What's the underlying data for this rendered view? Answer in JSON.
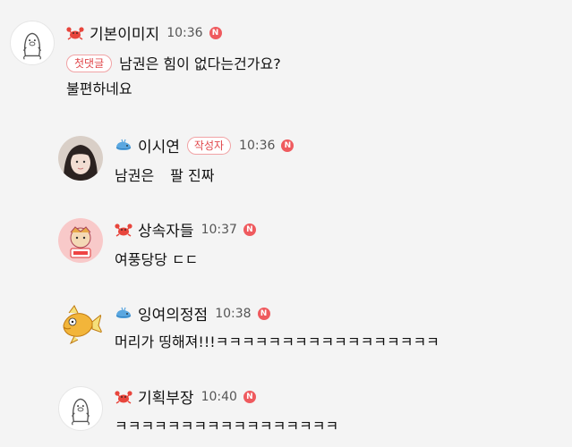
{
  "comments": [
    {
      "nickname": "기본이미지",
      "time": "10:36",
      "new_badge": "N",
      "first_comment_badge": "첫댓글",
      "line1": "남권은 힘이 없다는건가요?",
      "line2": "불편하네요"
    },
    {
      "nickname": "이시연",
      "author_badge": "작성자",
      "time": "10:36",
      "new_badge": "N",
      "text_before": "남권은",
      "text_after": "팔 진짜"
    },
    {
      "nickname": "상속자들",
      "time": "10:37",
      "new_badge": "N",
      "text": "여풍당당 ㄷㄷ"
    },
    {
      "nickname": "잉여의정점",
      "time": "10:38",
      "new_badge": "N",
      "text": "머리가 띵해져!!!ㅋㅋㅋㅋㅋㅋㅋㅋㅋㅋㅋㅋㅋㅋㅋㅋㅋ"
    },
    {
      "nickname": "기획부장",
      "time": "10:40",
      "new_badge": "N",
      "text": "ㅋㅋㅋㅋㅋㅋㅋㅋㅋㅋㅋㅋㅋㅋㅋㅋㅋ"
    }
  ],
  "icons": {
    "crab": "crab-grade-icon",
    "whale": "whale-grade-icon",
    "default_avatar": "default-avatar-icon"
  },
  "colors": {
    "accent_red": "#ef5a5e",
    "badge_border": "#f1a3a5",
    "background": "#f4f4f4"
  }
}
